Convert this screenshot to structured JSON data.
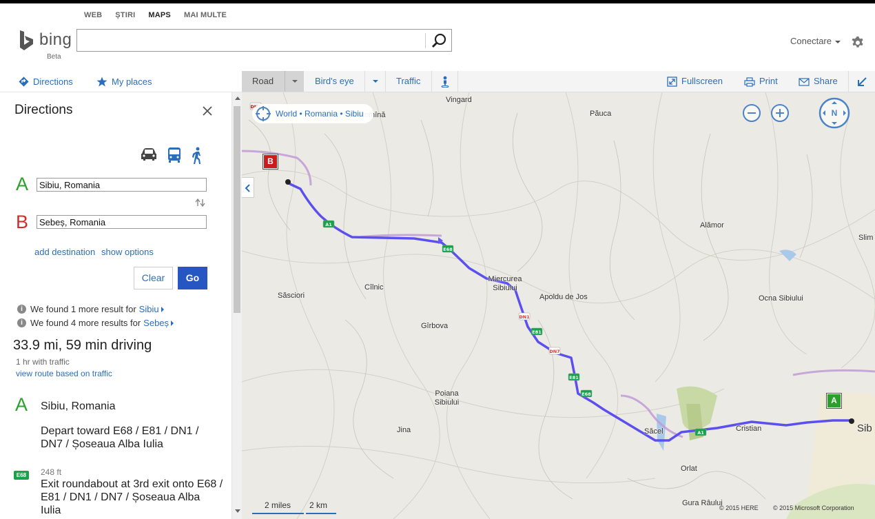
{
  "header": {
    "vertical_tabs": [
      "WEB",
      "ȘTIRI",
      "MAPS",
      "MAI MULTE"
    ],
    "active_tab": "MAPS",
    "logo_text": "bing",
    "logo_sub": "Beta",
    "search_value": "",
    "signin_label": "Conectare",
    "accent_color": "#2a6ebb"
  },
  "subnav": {
    "directions_label": "Directions",
    "myplaces_label": "My places"
  },
  "map_toolbar": {
    "road_label": "Road",
    "birds_eye_label": "Bird's eye",
    "traffic_label": "Traffic",
    "fullscreen_label": "Fullscreen",
    "print_label": "Print",
    "share_label": "Share"
  },
  "panel": {
    "title": "Directions",
    "waypoint_a_letter": "A",
    "waypoint_b_letter": "B",
    "waypoint_a_value": "Sibiu, Romania",
    "waypoint_b_value": "Sebeș, Romania",
    "add_destination": "add destination",
    "show_options": "show options",
    "clear_label": "Clear",
    "go_label": "Go",
    "info1_text": "We found 1 more result for",
    "info1_link": "Sibiu",
    "info2_text": "We found 4 more results for",
    "info2_link": "Sebeș",
    "summary": "33.9 mi, 59 min driving",
    "traffic_note": "1 hr with traffic",
    "traffic_link": "view route based on traffic",
    "step_a_letter": "A",
    "step_a_name": "Sibiu, Romania",
    "step_a_text": "Depart toward E68 / E81 / DN1 / DN7 / Șoseaua Alba Iulia",
    "step1_shield": "E68",
    "step1_distance": "248 ft",
    "step1_text": "Exit roundabout at 3rd exit onto E68 / E81 / DN1 / DN7 / Șoseaua Alba Iulia"
  },
  "map": {
    "breadcrumb": "World • Romania • Sibiu",
    "compass_label": "N",
    "pin_a": "A",
    "pin_b": "B",
    "places": [
      {
        "name": "Romînă"
      },
      {
        "name": "Vingard"
      },
      {
        "name": "Păuca"
      },
      {
        "name": "Alămor"
      },
      {
        "name": "Slim"
      },
      {
        "name": "Săsciori"
      },
      {
        "name": "Cîlnic"
      },
      {
        "name": "Miercurea\nSibiului"
      },
      {
        "name": "Apoldu de Jos"
      },
      {
        "name": "Ocna Sibiului"
      },
      {
        "name": "Gîrbova"
      },
      {
        "name": "Poiana\nSibiului"
      },
      {
        "name": "Jina"
      },
      {
        "name": "Săcel"
      },
      {
        "name": "Cristian"
      },
      {
        "name": "Sib"
      },
      {
        "name": "Orlat"
      },
      {
        "name": "Gura Râului"
      }
    ],
    "road_labels": [
      "DN1",
      "A1",
      "E68",
      "DN1",
      "E81",
      "DN7",
      "E81",
      "E68",
      "A1"
    ],
    "scale_miles": "2 miles",
    "scale_km": "2 km",
    "copyright_here": "© 2015 HERE",
    "copyright_ms": "© 2015 Microsoft Corporation",
    "route_color": "#5b4ff0"
  }
}
